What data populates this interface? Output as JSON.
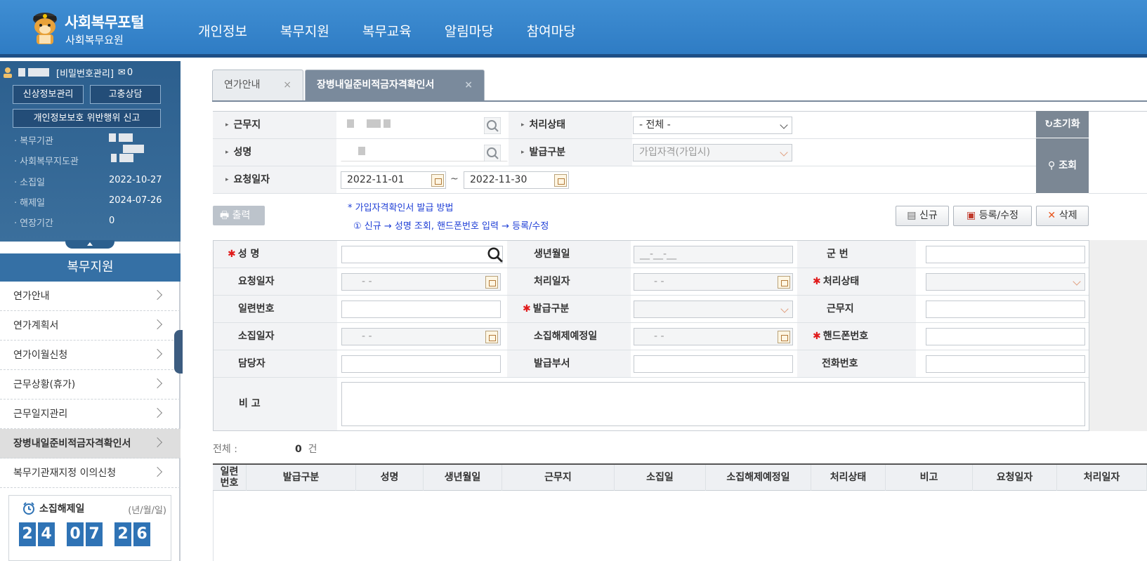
{
  "header": {
    "brand_title": "사회복무포털",
    "brand_sub": "사회복무요원",
    "nav": [
      "개인정보",
      "복무지원",
      "복무교육",
      "알림마당",
      "참여마당"
    ]
  },
  "sidebar": {
    "password_link": "[비밀번호관리]",
    "mail_count": "0",
    "btn_personal": "신상정보관리",
    "btn_counsel": "고충상담",
    "btn_report": "개인정보보호 위반행위 신고",
    "info": [
      {
        "label": "복무기관",
        "value": ""
      },
      {
        "label": "사회복무지도관",
        "value": ""
      },
      {
        "label": "소집일",
        "value": "2022-10-27"
      },
      {
        "label": "해제일",
        "value": "2024-07-26"
      },
      {
        "label": "연장기간",
        "value": "0"
      }
    ],
    "menu_title": "복무지원",
    "menu": [
      "연가안내",
      "연가계획서",
      "연가이월신청",
      "근무상황(휴가)",
      "근무일지관리",
      "장병내일준비적금자격확인서",
      "복무기관재지정 이의신청"
    ],
    "active_menu_index": 5,
    "dday": {
      "title": "소집해제일",
      "unit": "(년/월/일)",
      "digits": [
        "2",
        "4",
        "0",
        "7",
        "2",
        "6"
      ]
    }
  },
  "tabs": [
    {
      "label": "연가안내",
      "close": "×"
    },
    {
      "label": "장병내일준비적금자격확인서",
      "close": "×"
    }
  ],
  "search": {
    "workplace_label": "근무지",
    "status_label": "처리상태",
    "status_value": "- 전체 -",
    "name_label": "성명",
    "issue_label": "발급구분",
    "issue_value": "가입자격(가입시)",
    "date_label": "요청일자",
    "date_from": "2022-11-01",
    "date_sep": "~",
    "date_to": "2022-11-30",
    "reset_label": "초기화",
    "search_label": "조회"
  },
  "toolbar": {
    "print_label": "출력",
    "notice_title": "* 가입자격확인서 발급 방법",
    "notice_step": "① 신규 → 성명 조회, 핸드폰번호 입력 → 등록/수정",
    "new_label": "신규",
    "save_label": "등록/수정",
    "delete_label": "삭제"
  },
  "detail": {
    "name": "성 명",
    "birth": "생년월일",
    "birth_placeholder": "__-__-__",
    "army_no": "군 번",
    "req_date": "요청일자",
    "proc_date": "처리일자",
    "proc_status": "처리상태",
    "serial": "일련번호",
    "issue_type": "발급구분",
    "workplace": "근무지",
    "call_date": "소집일자",
    "release_date": "소집해제예정일",
    "phone": "핸드폰번호",
    "manager": "담당자",
    "issue_dept": "발급부서",
    "tel": "전화번호",
    "remark": "비 고",
    "date_empty": "-  -"
  },
  "results": {
    "total_label": "전체 :",
    "count": "0",
    "unit": "건",
    "columns": [
      "일련\n번호",
      "발급구분",
      "성명",
      "생년월일",
      "근무지",
      "소집일",
      "소집해제예정일",
      "처리상태",
      "비고",
      "요청일자",
      "처리일자"
    ]
  }
}
